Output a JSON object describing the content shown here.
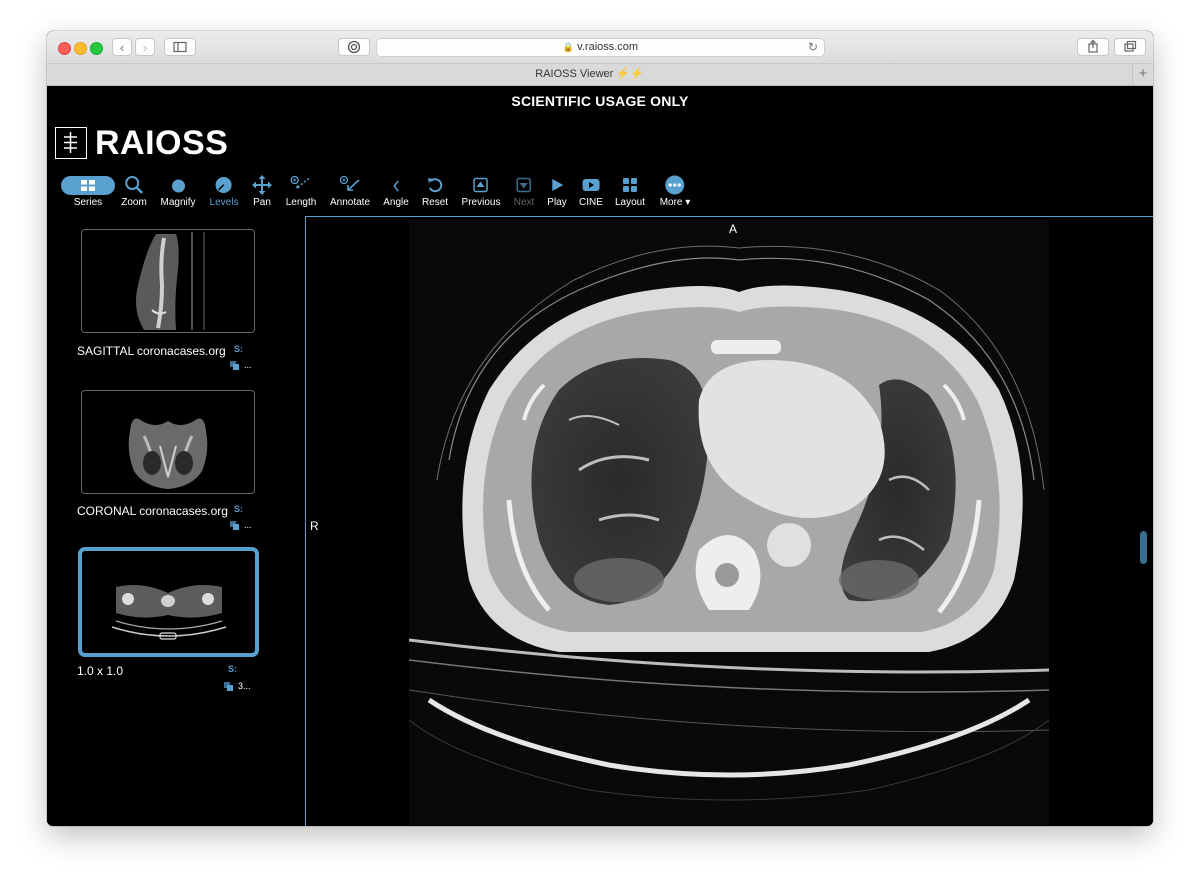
{
  "browser": {
    "url": "v.raioss.com",
    "tab_title": "RAIOSS Viewer ⚡️⚡️",
    "new_tab_symbol": "+"
  },
  "app": {
    "banner": "SCIENTIFIC USAGE ONLY",
    "logo_text": "RAIOSS",
    "accent_color": "#5aa0ce",
    "toolbar": [
      {
        "id": "series",
        "label": "Series",
        "icon": "grid-icon",
        "state": "selected"
      },
      {
        "id": "zoom",
        "label": "Zoom",
        "icon": "search-icon",
        "state": "normal"
      },
      {
        "id": "magnify",
        "label": "Magnify",
        "icon": "circle-icon",
        "state": "normal"
      },
      {
        "id": "levels",
        "label": "Levels",
        "icon": "contrast-icon",
        "state": "active"
      },
      {
        "id": "pan",
        "label": "Pan",
        "icon": "move-arrows-icon",
        "state": "normal"
      },
      {
        "id": "length",
        "label": "Length",
        "icon": "ruler-icon",
        "state": "normal"
      },
      {
        "id": "annotate",
        "label": "Annotate",
        "icon": "annotate-arrow-icon",
        "state": "normal"
      },
      {
        "id": "angle",
        "label": "Angle",
        "icon": "angle-icon",
        "state": "normal"
      },
      {
        "id": "reset",
        "label": "Reset",
        "icon": "undo-icon",
        "state": "normal"
      },
      {
        "id": "previous",
        "label": "Previous",
        "icon": "previous-icon",
        "state": "normal"
      },
      {
        "id": "next",
        "label": "Next",
        "icon": "next-icon",
        "state": "disabled"
      },
      {
        "id": "play",
        "label": "Play",
        "icon": "play-icon",
        "state": "normal"
      },
      {
        "id": "cine",
        "label": "CINE",
        "icon": "video-icon",
        "state": "normal"
      },
      {
        "id": "layout",
        "label": "Layout",
        "icon": "layout-icon",
        "state": "normal"
      },
      {
        "id": "more",
        "label": "More ▾",
        "icon": "more-dots-icon",
        "state": "normal"
      }
    ],
    "series": [
      {
        "label": "SAGITTAL coronacases.org",
        "s_tag": "S:",
        "count": "...",
        "selected": false
      },
      {
        "label": "CORONAL coronacases.org",
        "s_tag": "S:",
        "count": "...",
        "selected": false
      },
      {
        "label": "1.0 x 1.0",
        "s_tag": "S:",
        "count": "3...",
        "selected": true
      }
    ],
    "viewport": {
      "orientation_top": "A",
      "orientation_left": "R"
    }
  }
}
